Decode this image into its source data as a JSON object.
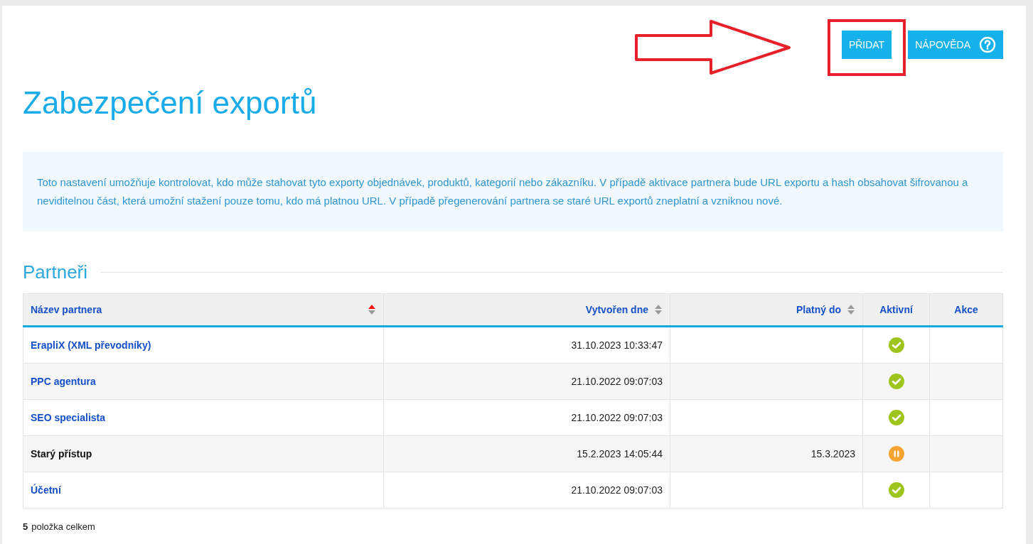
{
  "header": {
    "buttons": [
      {
        "label": "PŘIDAT",
        "highlighted": true,
        "help_icon": false
      },
      {
        "label": "NÁPOVĚDA",
        "highlighted": false,
        "help_icon": true
      }
    ]
  },
  "title": "Zabezpečení exportů",
  "info": "Toto nastavení umožňuje kontrolovat, kdo může stahovat tyto exporty objednávek, produktů, kategorií nebo zákazníku. V případě aktivace partnera bude URL exportu a hash obsahovat šifrovanou a neviditelnou část, která umožní stažení pouze tomu, kdo má platnou URL. V případě přegenerování partnera se staré URL exportů zneplatní a vzniknou nové.",
  "section_title": "Partneři",
  "table": {
    "columns": [
      {
        "label": "Název partnera",
        "sortable": true,
        "sorted": true
      },
      {
        "label": "Vytvořen dne",
        "sortable": true,
        "sorted": false
      },
      {
        "label": "Platný do",
        "sortable": true,
        "sorted": false
      },
      {
        "label": "Aktivní",
        "sortable": false
      },
      {
        "label": "Akce",
        "sortable": false
      }
    ],
    "rows": [
      {
        "name": "ErapliX (XML převodníky)",
        "link": true,
        "created": "31.10.2023 10:33:47",
        "paused": false
      },
      {
        "name": "PPC agentura",
        "link": true,
        "created": "21.10.2022 09:07:03",
        "paused": false
      },
      {
        "name": "SEO specialista",
        "link": true,
        "created": "21.10.2022 09:07:03",
        "paused": false
      },
      {
        "name": "Starý přístup",
        "link": false,
        "created": "15.2.2023 14:05:44",
        "valid_until": "15.3.2023",
        "paused": true
      },
      {
        "name": "Účetní",
        "link": true,
        "created": "21.10.2022 09:07:03",
        "paused": false
      }
    ]
  },
  "footer": {
    "count": "5",
    "label": "položka celkem"
  }
}
